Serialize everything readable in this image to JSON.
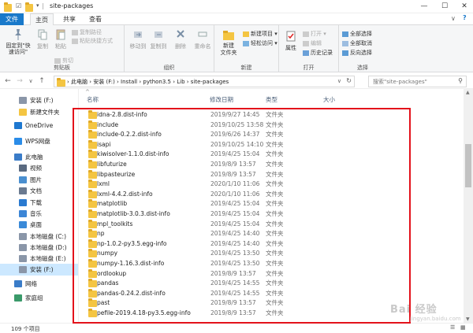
{
  "window": {
    "title": "site-packages",
    "controls": [
      "—",
      "☐",
      "✕"
    ]
  },
  "tabs": {
    "file": "文件",
    "home": "主页",
    "share": "共享",
    "view": "查看"
  },
  "ribbon": {
    "clipboard": {
      "pin": "固定到\"快\n速访问\"",
      "copy": "复制",
      "paste": "粘贴",
      "copy_path": "复制路径",
      "paste_shortcut": "粘贴快捷方式",
      "cut": "剪切",
      "label": "剪贴板"
    },
    "organize": {
      "move_to": "移动到",
      "copy_to": "复制到",
      "delete": "删除",
      "rename": "重命名",
      "label": "组织"
    },
    "new": {
      "new_folder": "新建\n文件夹",
      "new_item": "新建项目 ▾",
      "easy_access": "轻松访问 ▾",
      "label": "新建"
    },
    "open": {
      "properties": "属性",
      "open": "打开 ▾",
      "edit": "编辑",
      "history": "历史记录",
      "label": "打开"
    },
    "select": {
      "select_all": "全部选择",
      "select_none": "全部取消",
      "invert": "反向选择",
      "label": "选择"
    }
  },
  "address": {
    "back": "←",
    "forward": "→",
    "down": "∨",
    "up": "↑",
    "crumbs": "›  此电脑  ›  安装 (F:)  ›  Install  ›  python3.5  ›  Lib  ›  site-packages",
    "search_placeholder": "搜索\"site-packages\""
  },
  "nav": [
    {
      "label": "安装 (F:)",
      "icon": "drive-icon",
      "indent": 24
    },
    {
      "label": "新建文件夹",
      "icon": "folder-icon",
      "indent": 24
    },
    {
      "label": "OneDrive",
      "icon": "cloud-icon",
      "indent": 18
    },
    {
      "label": "WPS网盘",
      "icon": "wps-cloud-icon",
      "indent": 18
    },
    {
      "label": "此电脑",
      "icon": "computer-icon",
      "indent": 18
    },
    {
      "label": "视频",
      "icon": "video-icon",
      "indent": 24
    },
    {
      "label": "图片",
      "icon": "picture-icon",
      "indent": 24
    },
    {
      "label": "文档",
      "icon": "document-icon",
      "indent": 24
    },
    {
      "label": "下载",
      "icon": "download-icon",
      "indent": 24
    },
    {
      "label": "音乐",
      "icon": "music-icon",
      "indent": 24
    },
    {
      "label": "桌面",
      "icon": "desktop-icon",
      "indent": 24
    },
    {
      "label": "本地磁盘 (C:)",
      "icon": "drive-icon",
      "indent": 24
    },
    {
      "label": "本地磁盘 (D:)",
      "icon": "drive-icon",
      "indent": 24
    },
    {
      "label": "本地磁盘 (E:)",
      "icon": "drive-icon",
      "indent": 24
    },
    {
      "label": "安装 (F:)",
      "icon": "drive-icon",
      "indent": 24,
      "selected": true
    },
    {
      "label": "网络",
      "icon": "network-icon",
      "indent": 18
    },
    {
      "label": "家庭组",
      "icon": "homegroup-icon",
      "indent": 18
    }
  ],
  "columns": {
    "name": "名称",
    "date": "修改日期",
    "type": "类型",
    "size": "大小",
    "sort": "^"
  },
  "files": [
    {
      "name": "idna-2.8.dist-info",
      "date": "2019/9/27 14:45",
      "type": "文件夹"
    },
    {
      "name": "include",
      "date": "2019/10/25 13:58",
      "type": "文件夹"
    },
    {
      "name": "include-0.2.2.dist-info",
      "date": "2019/6/26 14:37",
      "type": "文件夹"
    },
    {
      "name": "isapi",
      "date": "2019/10/25 14:10",
      "type": "文件夹"
    },
    {
      "name": "kiwisolver-1.1.0.dist-info",
      "date": "2019/4/25 15:04",
      "type": "文件夹"
    },
    {
      "name": "libfuturize",
      "date": "2019/8/9 13:57",
      "type": "文件夹"
    },
    {
      "name": "libpasteurize",
      "date": "2019/8/9 13:57",
      "type": "文件夹"
    },
    {
      "name": "lxml",
      "date": "2020/1/10 11:06",
      "type": "文件夹"
    },
    {
      "name": "lxml-4.4.2.dist-info",
      "date": "2020/1/10 11:06",
      "type": "文件夹"
    },
    {
      "name": "matplotlib",
      "date": "2019/4/25 15:04",
      "type": "文件夹"
    },
    {
      "name": "matplotlib-3.0.3.dist-info",
      "date": "2019/4/25 15:04",
      "type": "文件夹"
    },
    {
      "name": "mpl_toolkits",
      "date": "2019/4/25 15:04",
      "type": "文件夹"
    },
    {
      "name": "np",
      "date": "2019/4/25 14:40",
      "type": "文件夹"
    },
    {
      "name": "np-1.0.2-py3.5.egg-info",
      "date": "2019/4/25 14:40",
      "type": "文件夹"
    },
    {
      "name": "numpy",
      "date": "2019/4/25 13:50",
      "type": "文件夹"
    },
    {
      "name": "numpy-1.16.3.dist-info",
      "date": "2019/4/25 13:50",
      "type": "文件夹"
    },
    {
      "name": "ordlookup",
      "date": "2019/8/9 13:57",
      "type": "文件夹"
    },
    {
      "name": "pandas",
      "date": "2019/4/25 14:55",
      "type": "文件夹"
    },
    {
      "name": "pandas-0.24.2.dist-info",
      "date": "2019/4/25 14:55",
      "type": "文件夹"
    },
    {
      "name": "past",
      "date": "2019/8/9 13:57",
      "type": "文件夹"
    },
    {
      "name": "pefile-2019.4.18-py3.5.egg-info",
      "date": "2019/8/9 13:57",
      "type": "文件夹"
    }
  ],
  "status": {
    "count": "109 个项目"
  },
  "watermark": {
    "main": "Bai 经验",
    "sub": "jingyan.baidu.com"
  },
  "colors": {
    "accent": "#1979ca",
    "highlight_box": "#e3121b",
    "folder": "#f4c542",
    "selected_nav": "#cce8ff"
  }
}
